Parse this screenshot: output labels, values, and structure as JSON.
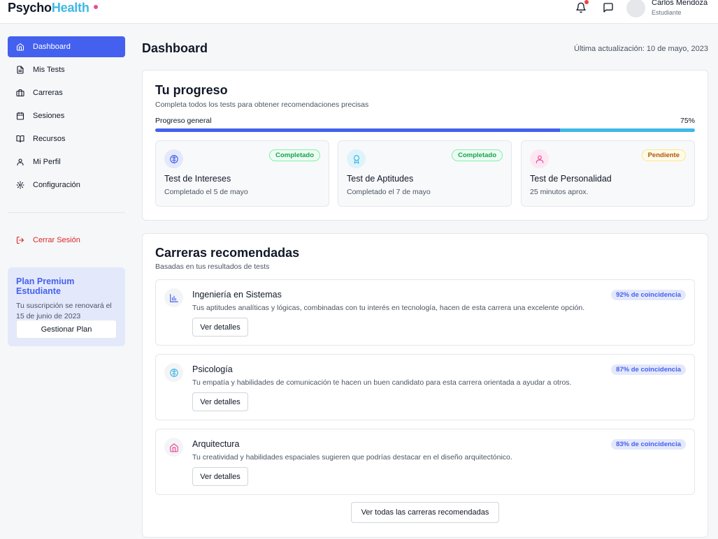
{
  "header": {
    "logo_part1": "Psycho",
    "logo_part2": "Health",
    "user_name": "Carlos Mendoza",
    "user_role": "Estudiante",
    "icons": [
      "bell-icon",
      "message-icon",
      "avatar"
    ]
  },
  "sidebar": {
    "items": [
      {
        "label": "Dashboard",
        "icon": "home-icon",
        "active": true
      },
      {
        "label": "Mis Tests",
        "icon": "document-icon"
      },
      {
        "label": "Carreras",
        "icon": "briefcase-icon"
      },
      {
        "label": "Sesiones",
        "icon": "calendar-icon"
      },
      {
        "label": "Recursos",
        "icon": "book-icon"
      },
      {
        "label": "Mi Perfil",
        "icon": "user-icon"
      },
      {
        "label": "Configuración",
        "icon": "gear-icon"
      }
    ],
    "logout_label": "Cerrar Sesión",
    "premium": {
      "title": "Plan Premium Estudiante",
      "description": "Tu suscripción se renovará el 15 de junio de 2023",
      "button_label": "Gestionar Plan"
    }
  },
  "main": {
    "title": "Dashboard",
    "last_update": "Última actualización: 10 de mayo, 2023",
    "progress": {
      "title": "Tu progreso",
      "subtitle": "Completa todos los tests para obtener recomendaciones precisas",
      "label": "Progreso general",
      "percent_text": "75%",
      "percent": 75,
      "tests": [
        {
          "name": "Test de Intereses",
          "meta": "Completado el 5 de mayo",
          "status": "Completado",
          "icon": "brain-icon",
          "color": "#4361ee"
        },
        {
          "name": "Test de Aptitudes",
          "meta": "Completado el 7 de mayo",
          "status": "Completado",
          "icon": "award-icon",
          "color": "#3fb8e6"
        },
        {
          "name": "Test de Personalidad",
          "meta": "25 minutos aprox.",
          "status": "Pendiente",
          "icon": "user-icon",
          "color": "#ec4899"
        }
      ]
    },
    "careers": {
      "title": "Carreras recomendadas",
      "subtitle": "Basadas en tus resultados de tests",
      "items": [
        {
          "name": "Ingeniería en Sistemas",
          "match": "92% de coincidencia",
          "description": "Tus aptitudes analíticas y lógicas, combinadas con tu interés en tecnología, hacen de esta carrera una excelente opción.",
          "button": "Ver detalles",
          "icon": "bar-chart-icon"
        },
        {
          "name": "Psicología",
          "match": "87% de coincidencia",
          "description": "Tu empatía y habilidades de comunicación te hacen un buen candidato para esta carrera orientada a ayudar a otros.",
          "button": "Ver detalles",
          "icon": "brain-icon"
        },
        {
          "name": "Arquitectura",
          "match": "83% de coincidencia",
          "description": "Tu creatividad y habilidades espaciales sugieren que podrías destacar en el diseño arquitectónico.",
          "button": "Ver detalles",
          "icon": "home-icon"
        }
      ],
      "all_button": "Ver todas las carreras recomendadas"
    }
  },
  "colors": {
    "primary": "#4361ee",
    "accent": "#3fb8e6",
    "pink": "#ec4899",
    "danger": "#dc2626"
  }
}
